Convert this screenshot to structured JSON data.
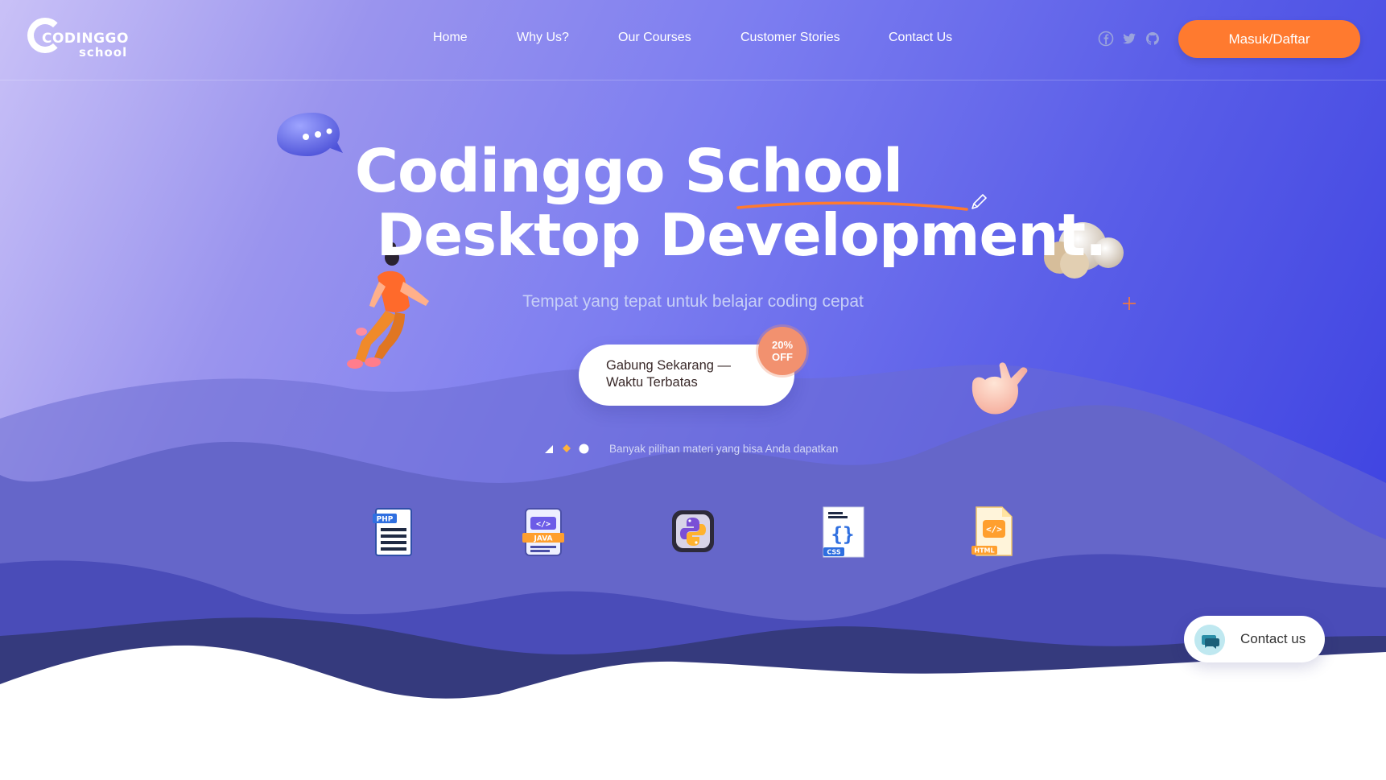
{
  "brand": {
    "logo_word1": "CODINGGO",
    "logo_word2": "school"
  },
  "nav": {
    "links": [
      {
        "label": "Home"
      },
      {
        "label": "Why Us?"
      },
      {
        "label": "Our Courses"
      },
      {
        "label": "Customer Stories"
      },
      {
        "label": "Contact Us"
      }
    ],
    "socials": [
      "facebook-icon",
      "twitter-icon",
      "github-icon"
    ],
    "login_label": "Masuk/Daftar"
  },
  "hero": {
    "title_line1": "Codinggo  School",
    "title_line2": "Desktop Development.",
    "subtitle": "Tempat yang tepat untuk belajar coding cepat",
    "cta_line1": "Gabung Sekarang —",
    "cta_line2": "Waktu Terbatas",
    "badge_line1": "20%",
    "badge_line2": "OFF",
    "slider_text": "Banyak pilihan materi yang bisa Anda dapatkan",
    "slider_active_index": 2
  },
  "languages": [
    {
      "name": "php-file-icon",
      "label": "PHP"
    },
    {
      "name": "java-file-icon",
      "label": "JAVA"
    },
    {
      "name": "python-icon",
      "label": ""
    },
    {
      "name": "css-file-icon",
      "label": "CSS"
    },
    {
      "name": "html-file-icon",
      "label": "HTML"
    }
  ],
  "contact": {
    "label": "Contact us"
  },
  "colors": {
    "accent": "#ff7a2f",
    "badge": "#f2916f",
    "gradient_start": "#c9c1f7",
    "gradient_end": "#3a3fe0"
  }
}
